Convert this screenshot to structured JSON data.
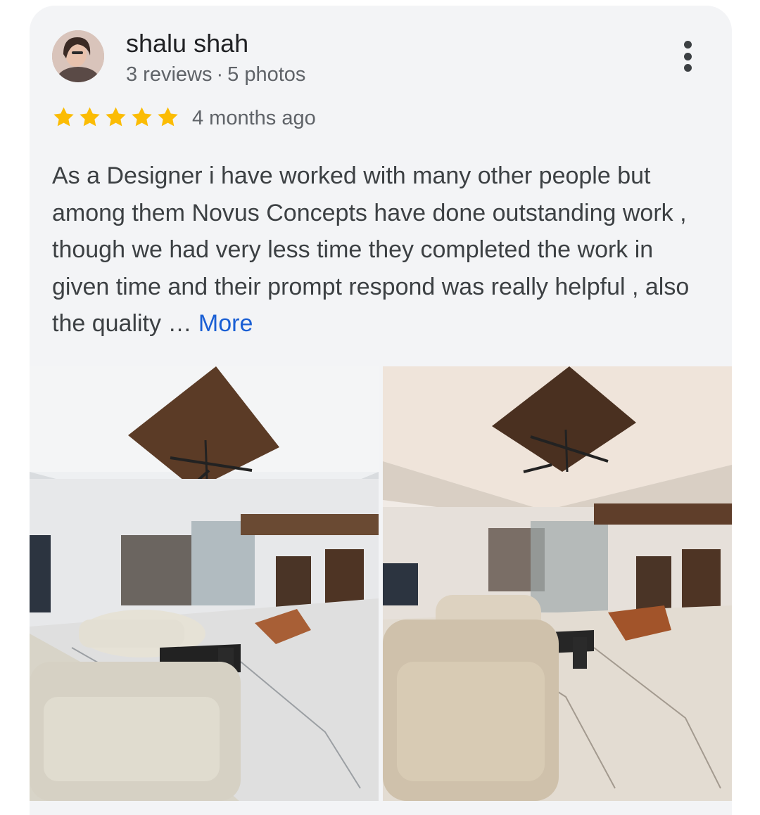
{
  "review": {
    "author_name": "shalu shah",
    "author_reviews": "3 reviews",
    "separator": "·",
    "author_photos": "5 photos",
    "rating": 5,
    "rating_max": 5,
    "time_ago": "4 months ago",
    "text": "As a Designer i have worked with many other people but among them Novus Concepts have done outstanding work , though we had very less time they completed the work in given time and their prompt respond was really helpful , also the quality …",
    "more_label": "More"
  },
  "photos": [
    {
      "icon": "living-room-photo-daylight"
    },
    {
      "icon": "living-room-photo-warm"
    }
  ],
  "colors": {
    "star": "#fbbc04",
    "link": "#1a5fd4",
    "card_bg": "#f3f4f6"
  }
}
